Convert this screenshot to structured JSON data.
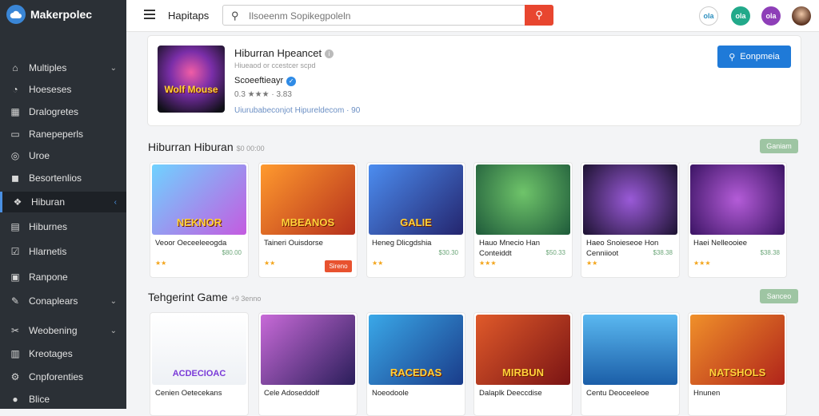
{
  "app": {
    "brand": "Makerpolec"
  },
  "sidebar": {
    "items": [
      {
        "label": "Multiples",
        "icon": "home-icon",
        "glyph": "⌂"
      },
      {
        "label": "Hoeseses",
        "icon": "gauge-icon",
        "glyph": "◔"
      },
      {
        "label": "Dralogretes",
        "icon": "grid-icon",
        "glyph": "▦"
      },
      {
        "label": "Ranepeperls",
        "icon": "window-icon",
        "glyph": "▭"
      },
      {
        "label": "Uroe",
        "icon": "gamepad-icon",
        "glyph": "◎"
      },
      {
        "label": "Besortenlios",
        "icon": "bag-icon",
        "glyph": "◼"
      },
      {
        "label": "Hiburan",
        "icon": "puzzle-icon",
        "glyph": "❖"
      },
      {
        "label": "Hiburnes",
        "icon": "document-icon",
        "glyph": "▤"
      },
      {
        "label": "Hlarnetis",
        "icon": "checkbox-icon",
        "glyph": "☑"
      },
      {
        "label": "Ranpone",
        "icon": "calendar-icon",
        "glyph": "▣"
      },
      {
        "label": "Conaplears",
        "icon": "wrench-icon",
        "glyph": "✎"
      },
      {
        "label": "Weobening",
        "icon": "tools-icon",
        "glyph": "✂"
      },
      {
        "label": "Kreotages",
        "icon": "archive-icon",
        "glyph": "▥"
      },
      {
        "label": "Cnpforenties",
        "icon": "settings-icon",
        "glyph": "⚙"
      },
      {
        "label": "Blice",
        "icon": "user-icon",
        "glyph": "●"
      }
    ]
  },
  "topbar": {
    "breadcrumb": "Hapitaps",
    "search_placeholder": "Ilsoeenm Sopikegpoleln",
    "icons": [
      {
        "label": "ola",
        "color": "#ffffff",
        "text": "#2d8fbf",
        "name": "chat-icon"
      },
      {
        "label": "ola",
        "color": "#22a98a",
        "text": "#ffffff",
        "name": "notification-icon"
      },
      {
        "label": "ola",
        "color": "#8e3fb8",
        "text": "#ffffff",
        "name": "apps-icon"
      }
    ]
  },
  "featured": {
    "title": "Hiburran Hpeancet",
    "subtitle": "Hiueaod or ccestcer scpd",
    "developer": "Scoeeftieayr",
    "rating_text": "0.3 ★★★ · 3.83",
    "meta": "Uiurubabeconjot Hipureldecom · 90",
    "download_label": "Eonpmeia",
    "thumb_text": "Wolf Mouse"
  },
  "sections": [
    {
      "title": "Hiburran Hiburan",
      "subtitle": "$0 00:00",
      "button": "Ganiam",
      "games": [
        {
          "name": "Veoor Oeceeleeogda",
          "price": "$80.00",
          "bg": "linear-gradient(135deg,#6fd2ff,#c45be0)",
          "art": "NEKNOR",
          "stars": "★★",
          "button": ""
        },
        {
          "name": "Taineri Ouisdorse",
          "price": "",
          "bg": "linear-gradient(135deg,#ff9a2e,#b5301c)",
          "art": "MBEANOS",
          "stars": "★★",
          "button": "Sireno"
        },
        {
          "name": "Heneg Dlicgdshia",
          "price": "$30.30",
          "bg": "linear-gradient(135deg,#4c8df0,#24256e)",
          "art": "GALIE",
          "stars": "★★",
          "button": ""
        },
        {
          "name": "Hauo Mnecio Han Conteiddt",
          "price": "$50.33",
          "bg": "radial-gradient(circle at 50% 40%,#6fc46a,#1e5a3a)",
          "art": "",
          "stars": "★★★",
          "button": ""
        },
        {
          "name": "Haeo Snoieseoe Hon Cenniioot",
          "price": "$38.38",
          "bg": "radial-gradient(circle at 50% 50%,#9a5ad8,#1c1230)",
          "art": "",
          "stars": "★★",
          "button": ""
        },
        {
          "name": "Haei Nelleooiee",
          "price": "$38.38",
          "bg": "radial-gradient(circle at 50% 50%,#b45cd8,#3b1464)",
          "art": "",
          "stars": "★★★",
          "button": ""
        }
      ]
    },
    {
      "title": "Tehgerint Game",
      "subtitle": "+9 3enno",
      "button": "Sanceo",
      "games": [
        {
          "name": "Cenien Oetecekans",
          "price": "",
          "bg": "linear-gradient(180deg,#ffffff,#eef1f5)",
          "art": "ACDECIOAC",
          "stars": "",
          "button": ""
        },
        {
          "name": "Cele Adoseddolf",
          "price": "",
          "bg": "linear-gradient(135deg,#c86ad8,#2a1e5a)",
          "art": "",
          "stars": "",
          "button": ""
        },
        {
          "name": "Noeodoole",
          "price": "",
          "bg": "linear-gradient(135deg,#3aa8e8,#1a3c8a)",
          "art": "RACEDAS",
          "stars": "",
          "button": ""
        },
        {
          "name": "Dalaplk Deeccdise",
          "price": "",
          "bg": "linear-gradient(135deg,#e05a2a,#7a1414)",
          "art": "MIRBUN",
          "stars": "",
          "button": ""
        },
        {
          "name": "Centu Deoceeleoe",
          "price": "",
          "bg": "linear-gradient(180deg,#5ab8f0,#1b5ea8)",
          "art": "",
          "stars": "",
          "button": ""
        },
        {
          "name": "Hnunen",
          "price": "",
          "bg": "linear-gradient(135deg,#f0902a,#b0241a)",
          "art": "NATSHOLS",
          "stars": "",
          "button": ""
        }
      ]
    }
  ],
  "colors": {
    "accent": "#1f7ad8",
    "sidebar": "#2b3036",
    "search_button": "#e8462f"
  }
}
